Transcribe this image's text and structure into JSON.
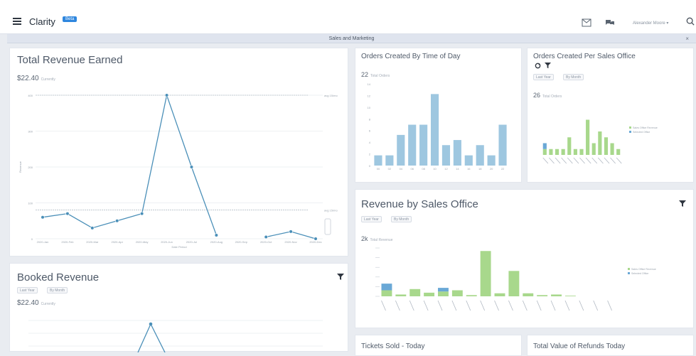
{
  "app": {
    "brand": "Clarity",
    "badge": "Beta",
    "user": "Alexander Moore"
  },
  "section": {
    "title": "Sales and Marketing",
    "close": "×"
  },
  "panels": {
    "total_revenue": {
      "title": "Total Revenue Earned",
      "value": "$22.40",
      "value_sub": "Currently"
    },
    "booked_revenue": {
      "title": "Booked Revenue",
      "value": "$22.40",
      "value_sub": "Currently",
      "chips": [
        "Last Year",
        "By Month"
      ]
    },
    "orders_time": {
      "title": "Orders Created By Time of Day",
      "value": "22",
      "value_sub": "Total Orders"
    },
    "orders_office": {
      "title": "Orders Created Per Sales Office",
      "value": "26",
      "value_sub": "Total Orders",
      "chips": [
        "Last Year",
        "By Month"
      ]
    },
    "revenue_office": {
      "title": "Revenue by Sales Office",
      "value": "2k",
      "value_sub": "Total Revenue",
      "chips": [
        "Last Year",
        "By Month"
      ]
    },
    "tickets_sold": {
      "title": "Tickets Sold - Today"
    },
    "refunds": {
      "title": "Total Value of Refunds Today"
    }
  },
  "chart_data": [
    {
      "type": "line",
      "name": "total_revenue",
      "categories": [
        "2020-Jan",
        "2020-Feb",
        "2020-Mar",
        "2020-Apr",
        "2020-May",
        "2020-Jun",
        "2020-Jul",
        "2020-Aug",
        "2020-Sep",
        "2020-Oct",
        "2020-Nov",
        "2020-Dec"
      ],
      "values": [
        6,
        7,
        3,
        5,
        7,
        40,
        20,
        1,
        null,
        0.5,
        2,
        0
      ],
      "ylim": [
        0,
        40
      ],
      "yticks": [
        "0",
        "100",
        "200",
        "300",
        "400"
      ],
      "series_color": "#4a8fb8",
      "reference_lines": [
        40,
        8
      ],
      "reference_labels": [
        "avg 15/mo",
        "avg 15/mo"
      ],
      "xlabel": "Date Period",
      "ylabel": "Revenue"
    },
    {
      "type": "line",
      "name": "booked_revenue",
      "values": [
        null,
        null,
        null,
        null,
        null,
        30,
        null
      ],
      "series_color": "#4a8fb8"
    },
    {
      "type": "bar",
      "name": "orders_time",
      "categories": [
        "00",
        "02",
        "04",
        "06",
        "08",
        "10",
        "12",
        "14",
        "16",
        "18",
        "20",
        "22"
      ],
      "values": [
        2,
        2,
        6,
        8,
        8,
        14,
        4,
        5,
        2,
        4,
        2,
        8
      ],
      "ylim": [
        0,
        16
      ],
      "yticks": [
        "0",
        "2",
        "4",
        "6",
        "8",
        "10",
        "12",
        "14"
      ],
      "color": "#9ec7e0"
    },
    {
      "type": "bar",
      "name": "orders_office",
      "categories": [
        "A",
        "B",
        "C",
        "D",
        "E",
        "F",
        "G",
        "H",
        "I",
        "J",
        "K",
        "L",
        "M"
      ],
      "series": [
        {
          "name": "Sales Office Revenue",
          "values": [
            1,
            1,
            1,
            1,
            3,
            1,
            1,
            6,
            2,
            4,
            3,
            2,
            1
          ],
          "color": "#a8d88c"
        },
        {
          "name": "Selected Office",
          "values": [
            1,
            0,
            0,
            0,
            0,
            0,
            0,
            0,
            0,
            0,
            0,
            0,
            0
          ],
          "color": "#6aa8d6"
        }
      ],
      "ylim": [
        0,
        8
      ]
    },
    {
      "type": "bar",
      "name": "revenue_office",
      "categories": [
        "A",
        "B",
        "C",
        "D",
        "E",
        "F",
        "G",
        "H",
        "I",
        "J",
        "K",
        "L",
        "M",
        "N",
        "O",
        "P",
        "Q"
      ],
      "series": [
        {
          "name": "Sales Office Revenue",
          "values": [
            1,
            0.3,
            1.2,
            0.6,
            0.8,
            1,
            0.2,
            7.5,
            0.5,
            4.2,
            0.5,
            0.2,
            0.3,
            0.1,
            0,
            0,
            0
          ],
          "color": "#a8d88c"
        },
        {
          "name": "Selected Office",
          "values": [
            1.1,
            0,
            0,
            0,
            0.6,
            0,
            0,
            0,
            0,
            0,
            0,
            0,
            0,
            0,
            0,
            0,
            0
          ],
          "color": "#6aa8d6"
        }
      ],
      "ylim": [
        0,
        8
      ]
    }
  ]
}
